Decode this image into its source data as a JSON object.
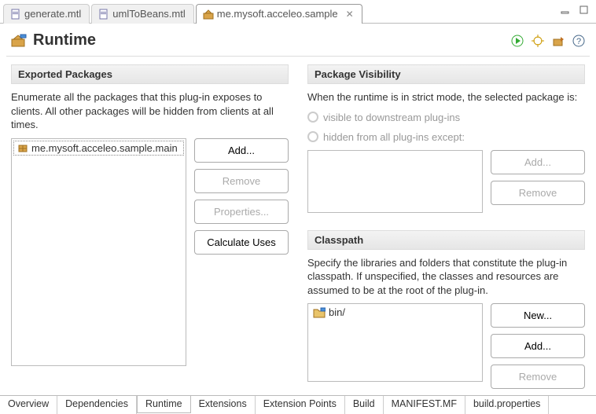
{
  "topTabs": [
    {
      "label": "generate.mtl"
    },
    {
      "label": "umlToBeans.mtl"
    },
    {
      "label": "me.mysoft.acceleo.sample",
      "active": true
    }
  ],
  "title": "Runtime",
  "exportedPackages": {
    "title": "Exported Packages",
    "desc": "Enumerate all the packages that this plug-in exposes to clients.  All other packages will be hidden from clients at all times.",
    "items": [
      "me.mysoft.acceleo.sample.main"
    ],
    "buttons": {
      "add": "Add...",
      "remove": "Remove",
      "properties": "Properties...",
      "calc": "Calculate Uses"
    }
  },
  "packageVisibility": {
    "title": "Package Visibility",
    "desc": "When the runtime is in strict mode, the selected package is:",
    "opt1": "visible to downstream plug-ins",
    "opt2": "hidden from all plug-ins except:",
    "buttons": {
      "add": "Add...",
      "remove": "Remove"
    }
  },
  "classpath": {
    "title": "Classpath",
    "desc": "Specify the libraries and folders that constitute the plug-in classpath.  If unspecified, the classes and resources are assumed to be at the root of the plug-in.",
    "items": [
      "bin/"
    ],
    "buttons": {
      "new": "New...",
      "add": "Add...",
      "remove": "Remove"
    }
  },
  "bottomTabs": [
    "Overview",
    "Dependencies",
    "Runtime",
    "Extensions",
    "Extension Points",
    "Build",
    "MANIFEST.MF",
    "build.properties"
  ],
  "activeBottomTab": "Runtime"
}
